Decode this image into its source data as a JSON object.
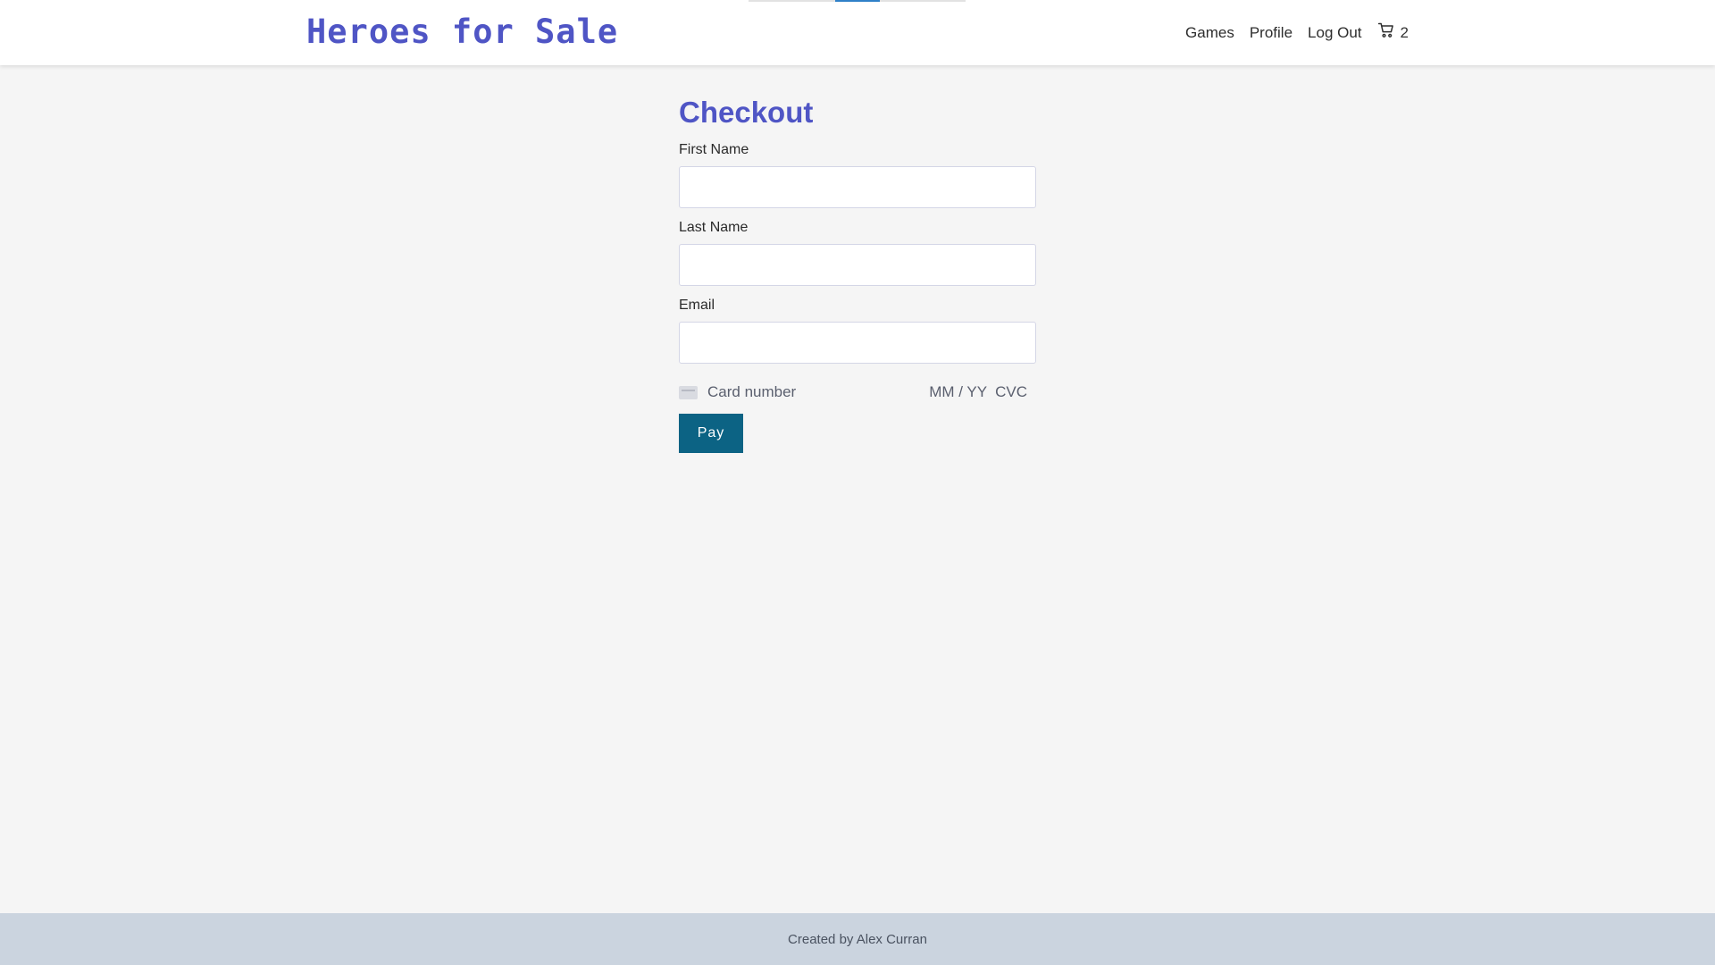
{
  "header": {
    "logo": "Heroes for Sale",
    "nav": [
      "Games",
      "Profile",
      "Log Out"
    ],
    "cart_count": "2",
    "cart_icon": "shopping-cart-icon"
  },
  "checkout": {
    "title": "Checkout",
    "first_name_label": "First Name",
    "last_name_label": "Last Name",
    "email_label": "Email",
    "card_number_placeholder": "Card number",
    "card_expiry_placeholder": "MM / YY",
    "card_cvc_placeholder": "CVC",
    "pay_button": "Pay"
  },
  "footer": {
    "text": "Created by Alex Curran"
  },
  "colors": {
    "brand": "#4f55c5",
    "button": "#0c6384",
    "footer_bg": "#cbd4df"
  }
}
